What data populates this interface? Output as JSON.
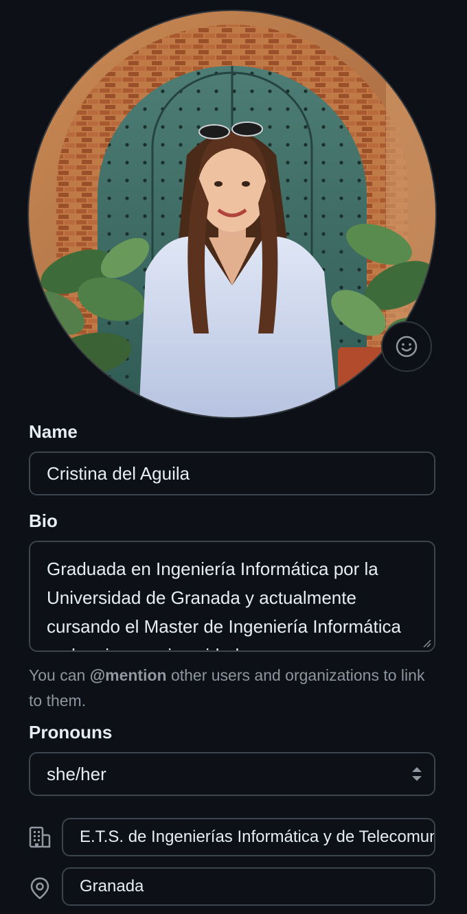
{
  "profile": {
    "avatar_alt": "Profile photo",
    "emoji_button_icon": "smiley-icon"
  },
  "name": {
    "label": "Name",
    "value": "Cristina del Aguila"
  },
  "bio": {
    "label": "Bio",
    "value": "Graduada en Ingeniería Informática por la Universidad de Granada y actualmente cursando el Master de Ingeniería Informática en la misma universidad.",
    "hint_prefix": "You can ",
    "hint_mention": "@mention",
    "hint_suffix": " other users and organizations to link to them."
  },
  "pronouns": {
    "label": "Pronouns",
    "selected": "she/her"
  },
  "company": {
    "icon": "organization-icon",
    "value": "E.T.S. de Ingenierías Informática y de Telecomunicación"
  },
  "location": {
    "icon": "location-pin-icon",
    "value": "Granada"
  },
  "colors": {
    "background": "#0d1117",
    "border": "#3d444d",
    "text": "#e6edf3",
    "muted": "#8d96a0"
  }
}
